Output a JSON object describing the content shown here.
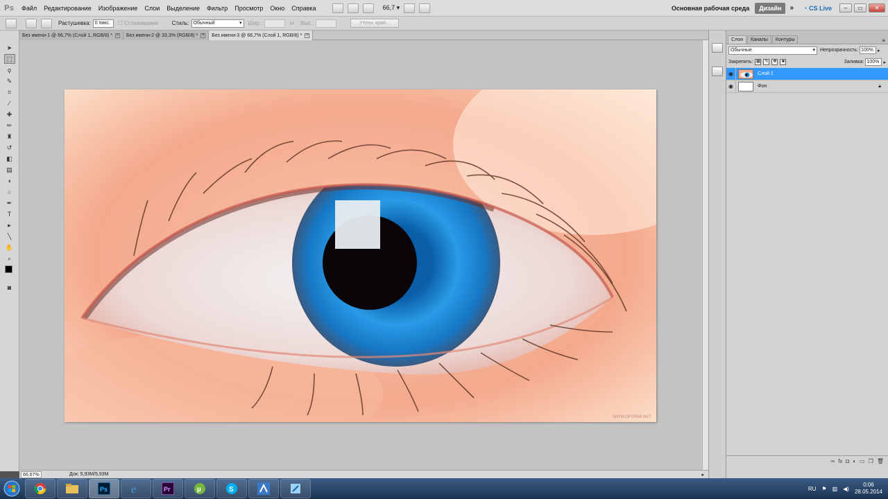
{
  "app": {
    "logo": "Ps"
  },
  "menu": [
    "Файл",
    "Редактирование",
    "Изображение",
    "Слои",
    "Выделение",
    "Фильтр",
    "Просмотр",
    "Окно",
    "Справка"
  ],
  "appbar": {
    "zoom": "66,7",
    "workspace": "Основная рабочая среда",
    "design_button": "Дизайн",
    "cs_live": "CS Live"
  },
  "options": {
    "feather_label": "Растушевка:",
    "feather_value": "0 пикс.",
    "antialias_label": "Сглаживание",
    "style_label": "Стиль:",
    "style_value": "Обычный",
    "width_label": "Шир.:",
    "height_label": "Выс.:",
    "refine_button": "Уточн. край..."
  },
  "tabs": [
    {
      "label": "Без имени-1 @ 66,7% (Слой 1, RGB/8) *"
    },
    {
      "label": "Без имени-2 @ 33,3% (RGB/8) *"
    },
    {
      "label": "Без имени-3 @ 66,7% (Слой 1, RGB/8) *"
    }
  ],
  "status": {
    "zoom": "66,67%",
    "doc": "Док: 5,93M/5,93M"
  },
  "image": {
    "watermark": "WWW.OFORMI.NET"
  },
  "layers_panel": {
    "tabs": [
      "Слои",
      "Каналы",
      "Контуры"
    ],
    "blend_mode": "Обычные",
    "opacity_label": "Непрозрачность:",
    "opacity_value": "100%",
    "lock_label": "Закрепить:",
    "fill_label": "Заливка:",
    "fill_value": "100%",
    "layers": [
      {
        "name": "Слой 1",
        "selected": true
      },
      {
        "name": "Фон",
        "selected": false
      }
    ]
  },
  "taskbar": {
    "language": "RU",
    "time": "0:06",
    "date": "28.05.2014"
  },
  "colors": {
    "accent": "#3399ff",
    "canvas_bg": "#c3c3c3",
    "iris": "#1e8ad6"
  }
}
